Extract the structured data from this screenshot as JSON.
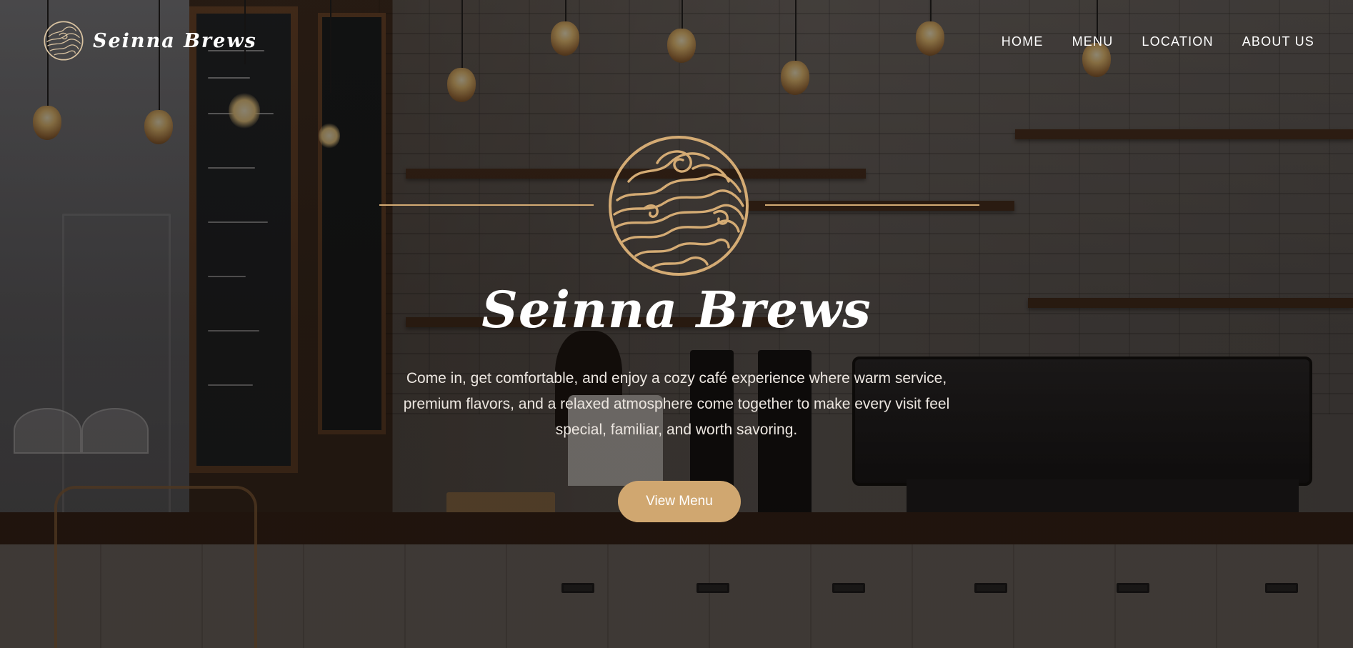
{
  "header": {
    "brand_name": "Seinna Brews",
    "nav": [
      {
        "label": "HOME"
      },
      {
        "label": "MENU"
      },
      {
        "label": "LOCATION"
      },
      {
        "label": "ABOUT US"
      }
    ]
  },
  "hero": {
    "title": "Seinna Brews",
    "tagline": "Come in, get comfortable, and enjoy a cozy café experience where warm service, premium flavors, and a relaxed atmosphere come together to make every visit feel special, familiar, and worth savoring.",
    "cta_label": "View Menu",
    "emblem_icon": "wave-swirl-emblem"
  },
  "colors": {
    "accent": "#d0a770",
    "emblem": "#d4ab74",
    "text": "#ffffff"
  }
}
